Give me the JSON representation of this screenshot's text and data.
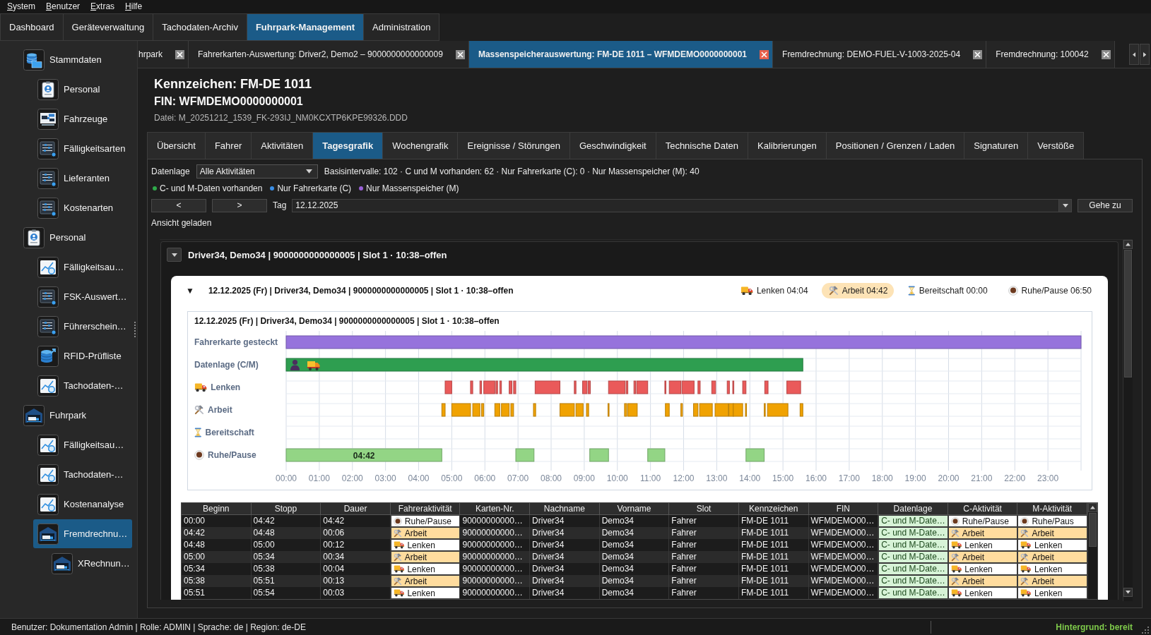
{
  "menu_bar": [
    "System",
    "Benutzer",
    "Extras",
    "Hilfe"
  ],
  "main_tabs": [
    {
      "label": "Dashboard",
      "selected": false
    },
    {
      "label": "Geräteverwaltung",
      "selected": false
    },
    {
      "label": "Tachodaten-Archiv",
      "selected": false
    },
    {
      "label": "Fuhrpark-Management",
      "selected": true
    },
    {
      "label": "Administration",
      "selected": false
    }
  ],
  "sidebar": {
    "items": [
      {
        "label": "Stammdaten",
        "kind": "database",
        "selected": false,
        "children": [
          {
            "label": "Personal",
            "kind": "badge",
            "selected": false
          },
          {
            "label": "Fahrzeuge",
            "kind": "vehicles",
            "selected": false
          },
          {
            "label": "Fälligkeitsarten",
            "kind": "list",
            "selected": false
          },
          {
            "label": "Lieferanten",
            "kind": "list",
            "selected": false
          },
          {
            "label": "Kostenarten",
            "kind": "list",
            "selected": false
          }
        ]
      },
      {
        "label": "Personal",
        "kind": "badge",
        "selected": false,
        "children": [
          {
            "label": "Fälligkeitsau…",
            "kind": "chart",
            "selected": false
          },
          {
            "label": "FSK-Auswert…",
            "kind": "list",
            "selected": false
          },
          {
            "label": "Führerschein…",
            "kind": "list",
            "selected": false
          },
          {
            "label": "RFID-Prüfliste",
            "kind": "db-export",
            "selected": false
          },
          {
            "label": "Tachodaten-…",
            "kind": "chart",
            "selected": false
          }
        ]
      },
      {
        "label": "Fuhrpark",
        "kind": "garage",
        "selected": false,
        "children": [
          {
            "label": "Fälligkeitsau…",
            "kind": "chart",
            "selected": false
          },
          {
            "label": "Tachodaten-…",
            "kind": "chart",
            "selected": false
          },
          {
            "label": "Kostenanalyse",
            "kind": "chart",
            "selected": false
          },
          {
            "label": "Fremdrechnu…",
            "kind": "garage",
            "selected": true,
            "children": [
              {
                "label": "XRechnun…",
                "kind": "garage",
                "selected": false
              }
            ]
          }
        ]
      }
    ]
  },
  "document_tabs": [
    {
      "label": "hrpark",
      "selected": false
    },
    {
      "label": "Fahrerkarten-Auswertung: Driver2, Demo2 – 9000000000000009",
      "selected": false
    },
    {
      "label": "Massenspeicherauswertung: FM-DE 1011 – WFMDEMO0000000001",
      "selected": true
    },
    {
      "label": "Fremdrechnung: DEMO-FUEL-V-1003-2025-04",
      "selected": false
    },
    {
      "label": "Fremdrechnung: 100042",
      "selected": false
    }
  ],
  "vehicle": {
    "plate": "Kennzeichen: FM-DE 1011",
    "fin": "FIN: WFMDEMO0000000001",
    "file": "Datei: M_20251212_1539_FK-293IJ_NM0KCXTP6KPE99326.DDD"
  },
  "section_tabs": [
    {
      "label": "Übersicht",
      "selected": false
    },
    {
      "label": "Fahrer",
      "selected": false
    },
    {
      "label": "Aktivitäten",
      "selected": false
    },
    {
      "label": "Tagesgrafik",
      "selected": true
    },
    {
      "label": "Wochengrafik",
      "selected": false
    },
    {
      "label": "Ereignisse / Störungen",
      "selected": false
    },
    {
      "label": "Geschwindigkeit",
      "selected": false
    },
    {
      "label": "Technische Daten",
      "selected": false
    },
    {
      "label": "Kalibrierungen",
      "selected": false
    },
    {
      "label": "Positionen / Grenzen / Laden",
      "selected": false
    },
    {
      "label": "Signaturen",
      "selected": false
    },
    {
      "label": "Verstöße",
      "selected": false
    }
  ],
  "filter": {
    "label": "Datenlage",
    "value": "Alle Aktivitäten",
    "summary": "Basisintervalle: 102 · C und M vorhanden: 62 · Nur Fahrerkarte (C): 0 · Nur Massenspeicher (M): 40"
  },
  "legend": [
    {
      "label": "C- und M-Daten vorhanden",
      "color": "#2faa4a"
    },
    {
      "label": "Nur Fahrerkarte (C)",
      "color": "#3a8ee6"
    },
    {
      "label": "Nur Massenspeicher (M)",
      "color": "#9a60d8"
    }
  ],
  "day_nav": {
    "prev": "<",
    "next": ">",
    "label": "Tag",
    "date": "12.12.2025",
    "go": "Gehe zu"
  },
  "status_message": "Ansicht geladen",
  "slot_section": {
    "title": "Driver34, Demo34 | 9000000000000005 | Slot 1 · 10:38–offen",
    "expanded": true,
    "day_card": {
      "toggle": "▼",
      "title": "12.12.2025 (Fr) | Driver34, Demo34 | 9000000000000005 | Slot 1 · 10:38–offen",
      "totals": [
        {
          "kind": "drive",
          "label": "Lenken 04:04",
          "selected": false
        },
        {
          "kind": "work",
          "label": "Arbeit 04:42",
          "selected": true
        },
        {
          "kind": "standby",
          "label": "Bereitschaft 00:00",
          "selected": false
        },
        {
          "kind": "rest",
          "label": "Ruhe/Pause 06:50",
          "selected": false
        }
      ],
      "timeline": {
        "title": "12.12.2025 (Fr) | Driver34, Demo34 | 9000000000000005 | Slot 1 · 10:38–offen",
        "rows": [
          {
            "label": "Fahrerkarte gesteckt",
            "kind": "card",
            "color": "#9673dc"
          },
          {
            "label": "Datenlage (C/M)",
            "kind": "data",
            "color": "#2e9e50"
          },
          {
            "label": "Lenken",
            "kind": "drive",
            "color": "#ea5a5a"
          },
          {
            "label": "Arbeit",
            "kind": "work",
            "color": "#f0a202"
          },
          {
            "label": "Bereitschaft",
            "kind": "standby"
          },
          {
            "label": "Ruhe/Pause",
            "kind": "rest",
            "color": "#93d585",
            "bar_label": "04:42"
          }
        ],
        "ticks": [
          "00:00",
          "01:00",
          "02:00",
          "03:00",
          "04:00",
          "05:00",
          "06:00",
          "07:00",
          "08:00",
          "09:00",
          "10:00",
          "11:00",
          "12:00",
          "13:00",
          "14:00",
          "15:00",
          "16:00",
          "17:00",
          "18:00",
          "19:00",
          "20:00",
          "21:00",
          "22:00",
          "23:00"
        ]
      },
      "table": {
        "columns": [
          "Beginn",
          "Stopp",
          "Dauer",
          "Fahreraktivität",
          "Karten-Nr.",
          "Nachname",
          "Vorname",
          "Slot",
          "Kennzeichen",
          "FIN",
          "Datenlage",
          "C-Aktivität",
          "M-Aktivität"
        ],
        "rows": [
          {
            "cells": [
              {
                "kind": "text",
                "text": "00:00"
              },
              {
                "kind": "text",
                "text": "04:42"
              },
              {
                "kind": "text",
                "text": "04:42"
              },
              {
                "kind": "rest",
                "text": "Ruhe/Pause"
              },
              {
                "kind": "text",
                "text": "90000000000…"
              },
              {
                "kind": "text",
                "text": "Driver34"
              },
              {
                "kind": "text",
                "text": "Demo34"
              },
              {
                "kind": "text",
                "text": "Fahrer"
              },
              {
                "kind": "text",
                "text": "FM-DE 1011"
              },
              {
                "kind": "text",
                "text": "WFMDEMO00…"
              },
              {
                "kind": "data",
                "text": "C- und M-Date…"
              },
              {
                "kind": "rest",
                "text": "Ruhe/Pause"
              },
              {
                "kind": "rest",
                "text": "Ruhe/Paus"
              }
            ]
          },
          {
            "cells": [
              {
                "kind": "text",
                "text": "04:42"
              },
              {
                "kind": "text",
                "text": "04:48"
              },
              {
                "kind": "text",
                "text": "00:06"
              },
              {
                "kind": "work",
                "text": "Arbeit"
              },
              {
                "kind": "text",
                "text": "90000000000…"
              },
              {
                "kind": "text",
                "text": "Driver34"
              },
              {
                "kind": "text",
                "text": "Demo34"
              },
              {
                "kind": "text",
                "text": "Fahrer"
              },
              {
                "kind": "text",
                "text": "FM-DE 1011"
              },
              {
                "kind": "text",
                "text": "WFMDEMO00…"
              },
              {
                "kind": "data",
                "text": "C- und M-Date…"
              },
              {
                "kind": "work",
                "text": "Arbeit"
              },
              {
                "kind": "work",
                "text": "Arbeit"
              }
            ]
          },
          {
            "cells": [
              {
                "kind": "text",
                "text": "04:48"
              },
              {
                "kind": "text",
                "text": "05:00"
              },
              {
                "kind": "text",
                "text": "00:12"
              },
              {
                "kind": "drive",
                "text": "Lenken"
              },
              {
                "kind": "text",
                "text": "90000000000…"
              },
              {
                "kind": "text",
                "text": "Driver34"
              },
              {
                "kind": "text",
                "text": "Demo34"
              },
              {
                "kind": "text",
                "text": "Fahrer"
              },
              {
                "kind": "text",
                "text": "FM-DE 1011"
              },
              {
                "kind": "text",
                "text": "WFMDEMO00…"
              },
              {
                "kind": "data",
                "text": "C- und M-Date…"
              },
              {
                "kind": "drive",
                "text": "Lenken"
              },
              {
                "kind": "drive",
                "text": "Lenken"
              }
            ]
          },
          {
            "cells": [
              {
                "kind": "text",
                "text": "05:00"
              },
              {
                "kind": "text",
                "text": "05:34"
              },
              {
                "kind": "text",
                "text": "00:34"
              },
              {
                "kind": "work",
                "text": "Arbeit"
              },
              {
                "kind": "text",
                "text": "90000000000…"
              },
              {
                "kind": "text",
                "text": "Driver34"
              },
              {
                "kind": "text",
                "text": "Demo34"
              },
              {
                "kind": "text",
                "text": "Fahrer"
              },
              {
                "kind": "text",
                "text": "FM-DE 1011"
              },
              {
                "kind": "text",
                "text": "WFMDEMO00…"
              },
              {
                "kind": "data",
                "text": "C- und M-Date…"
              },
              {
                "kind": "work",
                "text": "Arbeit"
              },
              {
                "kind": "work",
                "text": "Arbeit"
              }
            ]
          },
          {
            "cells": [
              {
                "kind": "text",
                "text": "05:34"
              },
              {
                "kind": "text",
                "text": "05:38"
              },
              {
                "kind": "text",
                "text": "00:04"
              },
              {
                "kind": "drive",
                "text": "Lenken"
              },
              {
                "kind": "text",
                "text": "90000000000…"
              },
              {
                "kind": "text",
                "text": "Driver34"
              },
              {
                "kind": "text",
                "text": "Demo34"
              },
              {
                "kind": "text",
                "text": "Fahrer"
              },
              {
                "kind": "text",
                "text": "FM-DE 1011"
              },
              {
                "kind": "text",
                "text": "WFMDEMO00…"
              },
              {
                "kind": "data",
                "text": "C- und M-Date…"
              },
              {
                "kind": "drive",
                "text": "Lenken"
              },
              {
                "kind": "drive",
                "text": "Lenken"
              }
            ]
          },
          {
            "cells": [
              {
                "kind": "text",
                "text": "05:38"
              },
              {
                "kind": "text",
                "text": "05:51"
              },
              {
                "kind": "text",
                "text": "00:13"
              },
              {
                "kind": "work",
                "text": "Arbeit"
              },
              {
                "kind": "text",
                "text": "90000000000…"
              },
              {
                "kind": "text",
                "text": "Driver34"
              },
              {
                "kind": "text",
                "text": "Demo34"
              },
              {
                "kind": "text",
                "text": "Fahrer"
              },
              {
                "kind": "text",
                "text": "FM-DE 1011"
              },
              {
                "kind": "text",
                "text": "WFMDEMO00…"
              },
              {
                "kind": "data",
                "text": "C- und M-Date…"
              },
              {
                "kind": "work",
                "text": "Arbeit"
              },
              {
                "kind": "work",
                "text": "Arbeit"
              }
            ]
          },
          {
            "cells": [
              {
                "kind": "text",
                "text": "05:51"
              },
              {
                "kind": "text",
                "text": "05:54"
              },
              {
                "kind": "text",
                "text": "00:03"
              },
              {
                "kind": "drive",
                "text": "Lenken"
              },
              {
                "kind": "text",
                "text": "90000000000…"
              },
              {
                "kind": "text",
                "text": "Driver34"
              },
              {
                "kind": "text",
                "text": "Demo34"
              },
              {
                "kind": "text",
                "text": "Fahrer"
              },
              {
                "kind": "text",
                "text": "FM-DE 1011"
              },
              {
                "kind": "text",
                "text": "WFMDEMO00…"
              },
              {
                "kind": "data",
                "text": "C- und M-Date…"
              },
              {
                "kind": "drive",
                "text": "Lenken"
              },
              {
                "kind": "drive",
                "text": "Lenken"
              }
            ]
          }
        ]
      }
    }
  },
  "status_bar": {
    "session": "Benutzer: Dokumentation Admin | Rolle: ADMIN | Sprache: de | Region: de-DE",
    "background": "Hintergrund: bereit"
  }
}
